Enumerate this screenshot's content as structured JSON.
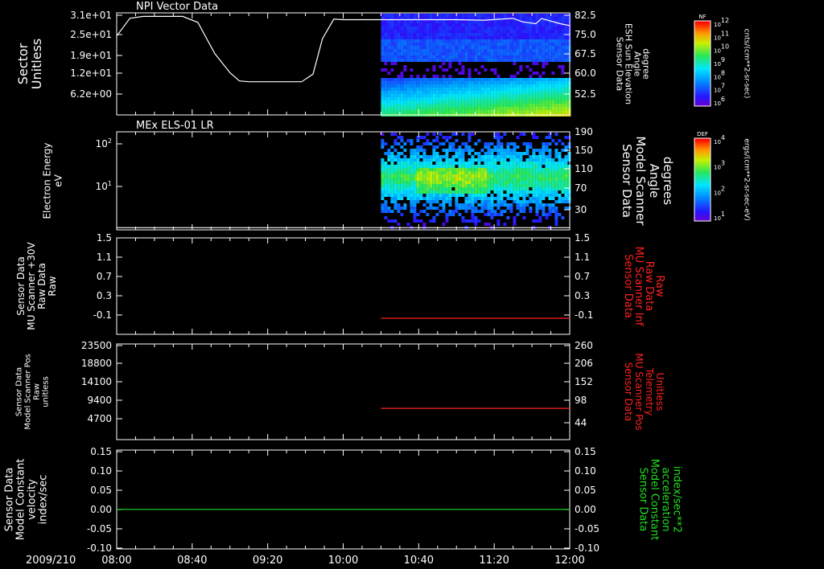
{
  "colors": {
    "background": "#000000",
    "axis": "#ffffff",
    "red": "#ff2020",
    "green": "#22dd22"
  },
  "chart_data": {
    "type": "line",
    "date_label": "2009/210",
    "x_ticks": [
      "08:00",
      "08:40",
      "09:20",
      "10:00",
      "10:40",
      "11:20",
      "12:00"
    ],
    "x_range": [
      "08:00",
      "12:00"
    ],
    "panels": [
      {
        "title": "NPI Vector Data",
        "type": "spectrogram+line",
        "left_label": [
          "Sector",
          "Unitless"
        ],
        "left_ticks": [
          "3.1e+01",
          "2.5e+01",
          "1.9e+01",
          "1.2e+01",
          "6.2e+00"
        ],
        "right_label": [
          "Sensor Data",
          "ESH Sun Elevation",
          "Angle",
          "degree"
        ],
        "right_ticks": [
          "82.5",
          "75.0",
          "67.5",
          "60.0",
          "52.5"
        ],
        "right_range": [
          45,
          82.5
        ],
        "spectrogram_start": "10:20",
        "colorbar": {
          "label": "NF",
          "units": "cnts/(cm**2-sr-sec)",
          "ticks": [
            "10^12",
            "10^11",
            "10^10",
            "10^9",
            "10^8",
            "10^7",
            "10^6"
          ]
        },
        "series": [
          {
            "axis": "right",
            "color": "#ffffff",
            "points": [
              [
                "08:00",
                74.0
              ],
              [
                "08:07",
                80.5
              ],
              [
                "08:14",
                81.2
              ],
              [
                "08:35",
                81.2
              ],
              [
                "08:43",
                79.0
              ],
              [
                "08:52",
                67.5
              ],
              [
                "09:00",
                60.5
              ],
              [
                "09:05",
                57.5
              ],
              [
                "09:10",
                57.2
              ],
              [
                "09:38",
                57.2
              ],
              [
                "09:44",
                60.0
              ],
              [
                "09:49",
                73.0
              ],
              [
                "09:55",
                80.2
              ],
              [
                "10:00",
                80.0
              ],
              [
                "10:20",
                80.0
              ],
              [
                "11:00",
                80.0
              ],
              [
                "11:15",
                79.8
              ],
              [
                "11:30",
                80.5
              ],
              [
                "11:35",
                79.2
              ],
              [
                "11:42",
                78.5
              ],
              [
                "11:45",
                80.4
              ],
              [
                "11:55",
                78.5
              ],
              [
                "12:00",
                77.8
              ]
            ]
          }
        ]
      },
      {
        "title": "MEx ELS-01 LR",
        "type": "spectrogram+line",
        "left_label": [
          "Electron Energy",
          "eV"
        ],
        "left_ticks": [
          "10^2",
          "10^1"
        ],
        "right_label": [
          "Sensor Data",
          "Model Scanner",
          "Angle",
          "degrees"
        ],
        "right_ticks": [
          "190",
          "150",
          "110",
          "70",
          "30"
        ],
        "right_range": [
          10,
          190
        ],
        "spectrogram_start": "10:20",
        "colorbar": {
          "label": "DEF",
          "units": "ergs/(cm**2-sr-sec-eV)",
          "ticks": [
            "10^4",
            "10^3",
            "10^2",
            "10^1"
          ]
        },
        "series": [
          {
            "axis": "right",
            "color": "#ffffff",
            "points": [
              [
                "08:00",
                14
              ],
              [
                "12:00",
                14
              ]
            ]
          }
        ]
      },
      {
        "title": "",
        "type": "line",
        "left_label": [
          "Sensor Data",
          "MU Scanner +30V",
          "Raw Data",
          "Raw"
        ],
        "left_ticks": [
          "1.5",
          "1.1",
          "0.7",
          "0.3",
          "-0.1"
        ],
        "right_label": [
          "Sensor Data",
          "MU Scanner Inf",
          "Raw Data",
          "Raw"
        ],
        "right_ticks": [
          "1.5",
          "1.1",
          "0.7",
          "0.3",
          "-0.1"
        ],
        "right_range": [
          -0.3,
          1.5
        ],
        "series": [
          {
            "axis": "right",
            "color": "#ff2020",
            "points": [
              [
                "10:20",
                0.0
              ],
              [
                "12:00",
                0.0
              ]
            ]
          }
        ]
      },
      {
        "title": "",
        "type": "line",
        "left_label": [
          "Sensor Data",
          "Model Scanner Pos",
          "Raw",
          "unitless"
        ],
        "left_ticks": [
          "23500",
          "18800",
          "14100",
          "9400",
          "4700"
        ],
        "right_label": [
          "Sensor Data",
          "MU Scanner Pos",
          "Telemetry",
          "Unitless"
        ],
        "right_ticks": [
          "260",
          "206",
          "152",
          "98",
          "44"
        ],
        "right_range": [
          0,
          260
        ],
        "series": [
          {
            "axis": "right",
            "color": "#ff2020",
            "points": [
              [
                "10:20",
                85
              ],
              [
                "12:00",
                85
              ]
            ]
          }
        ]
      },
      {
        "title": "",
        "type": "line",
        "left_label": [
          "Sensor Data",
          "Model Constant",
          "velocity",
          "index/sec"
        ],
        "left_ticks": [
          "0.15",
          "0.10",
          "0.05",
          "0.00",
          "-0.05",
          "-0.10"
        ],
        "right_label": [
          "Sensor Data",
          "Model Constant",
          "acceleration",
          "index/sec**2"
        ],
        "right_ticks": [
          "0.15",
          "0.10",
          "0.05",
          "0.00",
          "-0.05",
          "-0.10"
        ],
        "right_range": [
          -0.1,
          0.15
        ],
        "series": [
          {
            "axis": "left",
            "color": "#22dd22",
            "points": [
              [
                "08:00",
                0.0
              ],
              [
                "12:00",
                0.0
              ]
            ]
          }
        ]
      }
    ]
  }
}
